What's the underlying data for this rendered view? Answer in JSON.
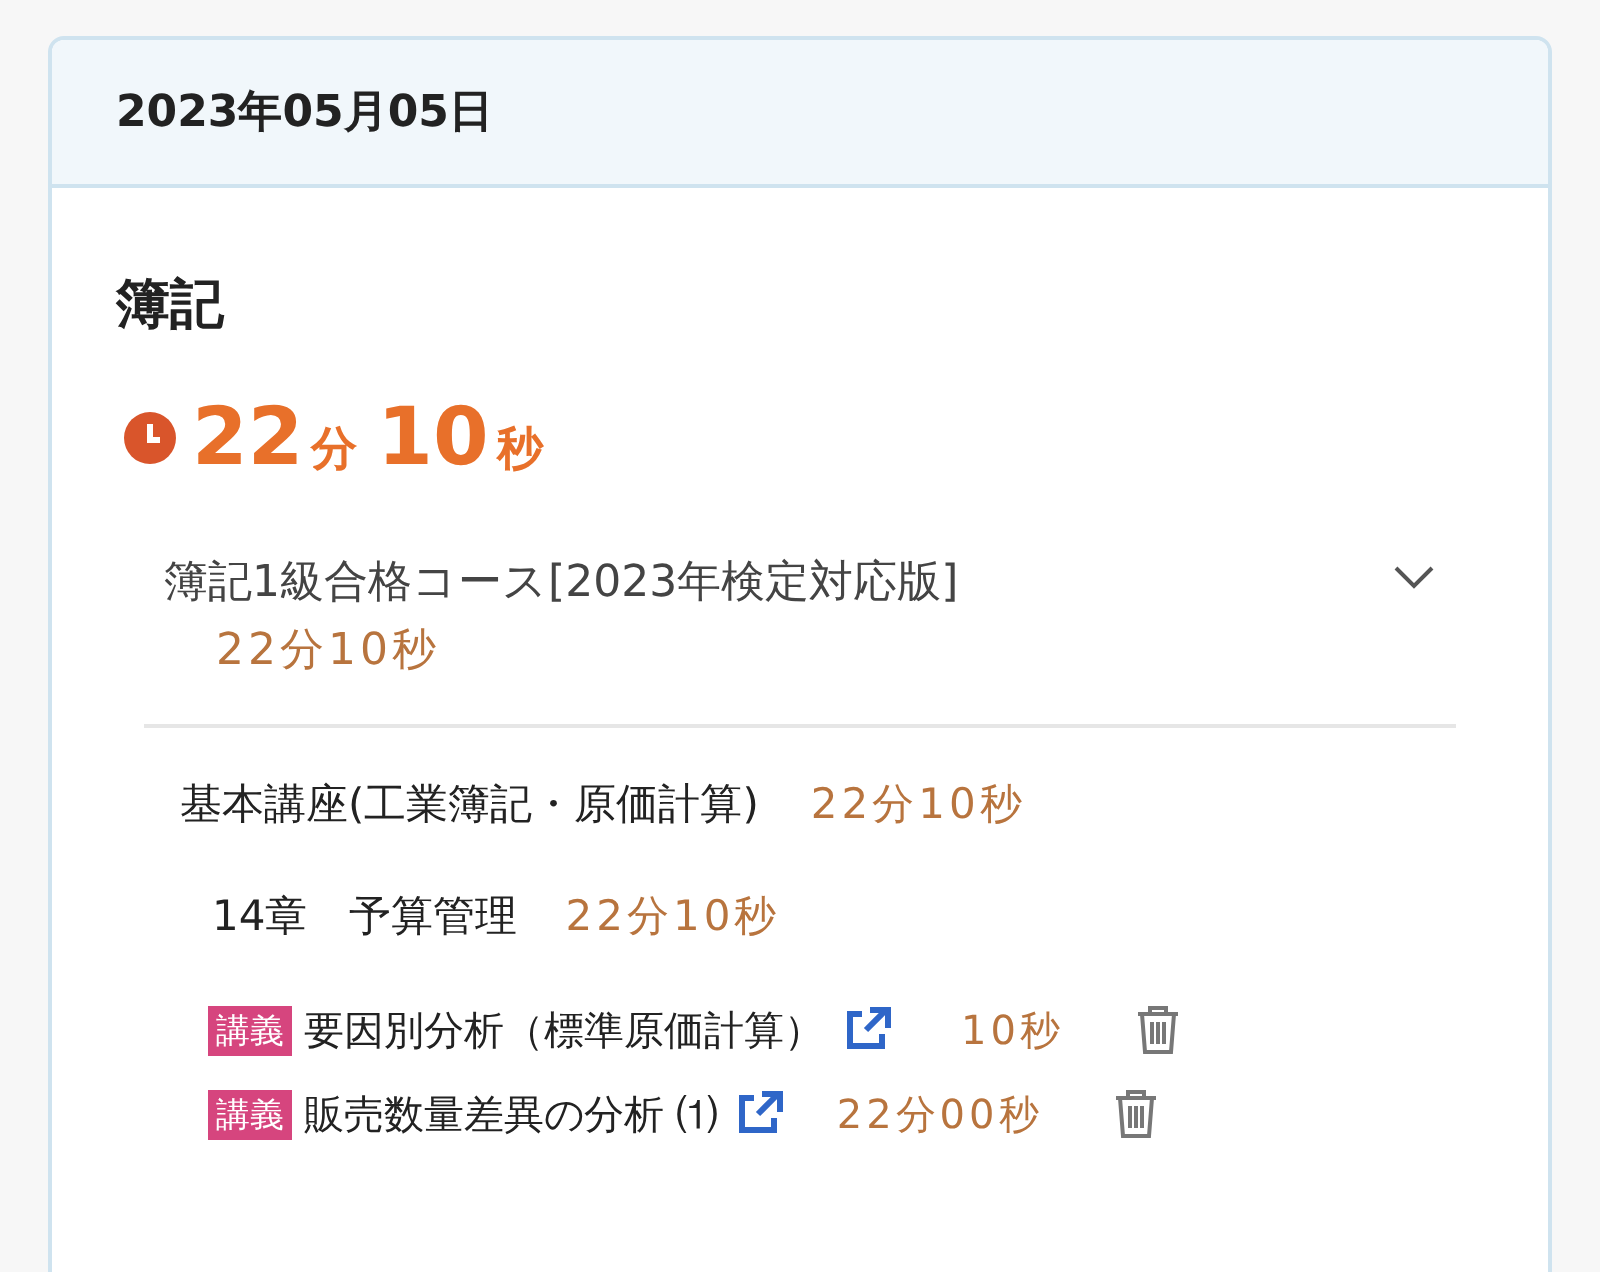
{
  "date": "2023年05月05日",
  "subject": "簿記",
  "total_time": [
    {
      "kind": "number",
      "text": "22"
    },
    {
      "kind": "unit",
      "text": "分"
    },
    {
      "kind": "number",
      "text": "10"
    },
    {
      "kind": "unit",
      "text": "秒"
    }
  ],
  "course": {
    "title": "簿記1級合格コース[2023年検定対応版]",
    "time": "22分10秒",
    "sections": [
      {
        "title": "基本講座(工業簿記・原価計算)",
        "time": "22分10秒",
        "chapters": [
          {
            "title": "14章　予算管理",
            "time": "22分10秒",
            "lectures": [
              {
                "tag": "講義",
                "title": "要因別分析（標準原価計算）",
                "time": "10秒"
              },
              {
                "tag": "講義",
                "title": "販売数量差異の分析 ⑴",
                "time": "22分00秒"
              }
            ]
          }
        ]
      }
    ]
  }
}
